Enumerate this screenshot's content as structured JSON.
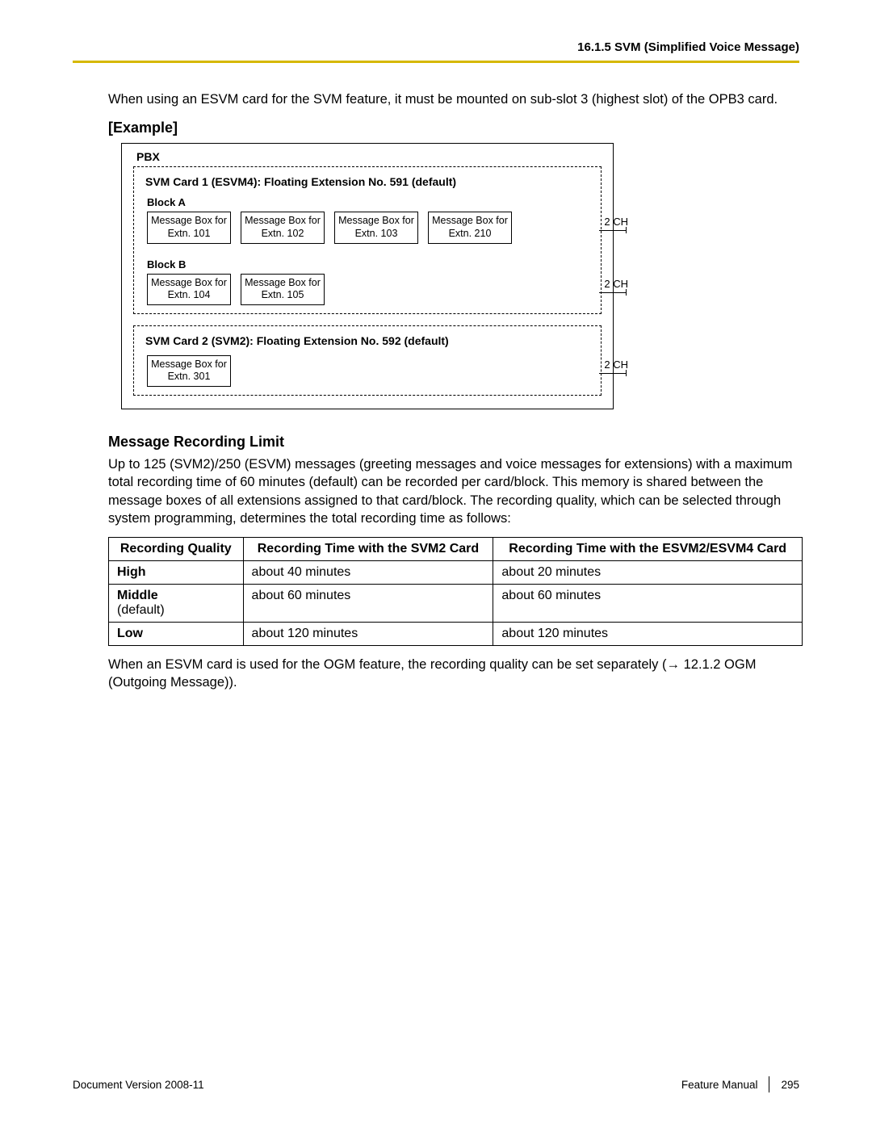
{
  "header": {
    "section": "16.1.5 SVM (Simplified Voice Message)"
  },
  "intro": "When using an ESVM card for the SVM feature, it must be mounted on sub-slot 3 (highest slot) of the OPB3 card.",
  "example_heading": "[Example]",
  "diagram": {
    "pbx_label": "PBX",
    "card1": {
      "title": "SVM Card 1 (ESVM4): Floating Extension No. 591 (default)",
      "blockA_label": "Block A",
      "blockA_boxes": [
        {
          "l1": "Message Box for",
          "l2": "Extn. 101"
        },
        {
          "l1": "Message Box for",
          "l2": "Extn. 102"
        },
        {
          "l1": "Message Box for",
          "l2": "Extn. 103"
        },
        {
          "l1": "Message Box for",
          "l2": "Extn. 210"
        }
      ],
      "blockA_ch": "2 CH",
      "blockB_label": "Block B",
      "blockB_boxes": [
        {
          "l1": "Message Box for",
          "l2": "Extn. 104"
        },
        {
          "l1": "Message Box for",
          "l2": "Extn. 105"
        }
      ],
      "blockB_ch": "2 CH"
    },
    "card2": {
      "title": "SVM Card 2 (SVM2): Floating Extension No. 592 (default)",
      "box": {
        "l1": "Message Box for",
        "l2": "Extn. 301"
      },
      "ch": "2 CH"
    }
  },
  "mrl_heading": "Message Recording Limit",
  "mrl_text": "Up to 125 (SVM2)/250 (ESVM) messages (greeting messages and voice messages for extensions) with a maximum total recording time of 60 minutes (default) can be recorded per card/block. This memory is shared between the message boxes of all extensions assigned to that card/block. The recording quality, which can be selected through system programming, determines the total recording time as follows:",
  "table": {
    "h1": "Recording Quality",
    "h2": "Recording Time with the SVM2 Card",
    "h3": "Recording Time with the ESVM2/ESVM4 Card",
    "rows": [
      {
        "q": "High",
        "note": "",
        "c2": "about 40 minutes",
        "c3": "about 20 minutes"
      },
      {
        "q": "Middle",
        "note": "(default)",
        "c2": "about 60 minutes",
        "c3": "about 60 minutes"
      },
      {
        "q": "Low",
        "note": "",
        "c2": "about 120 minutes",
        "c3": "about 120 minutes"
      }
    ]
  },
  "after_table_1": "When an ESVM card is used for the OGM feature, the recording quality can be set separately (",
  "after_table_ref": "→ 12.1.2  OGM (Outgoing Message)).",
  "footer": {
    "left": "Document Version  2008-11",
    "center": "Feature Manual",
    "page": "295"
  }
}
